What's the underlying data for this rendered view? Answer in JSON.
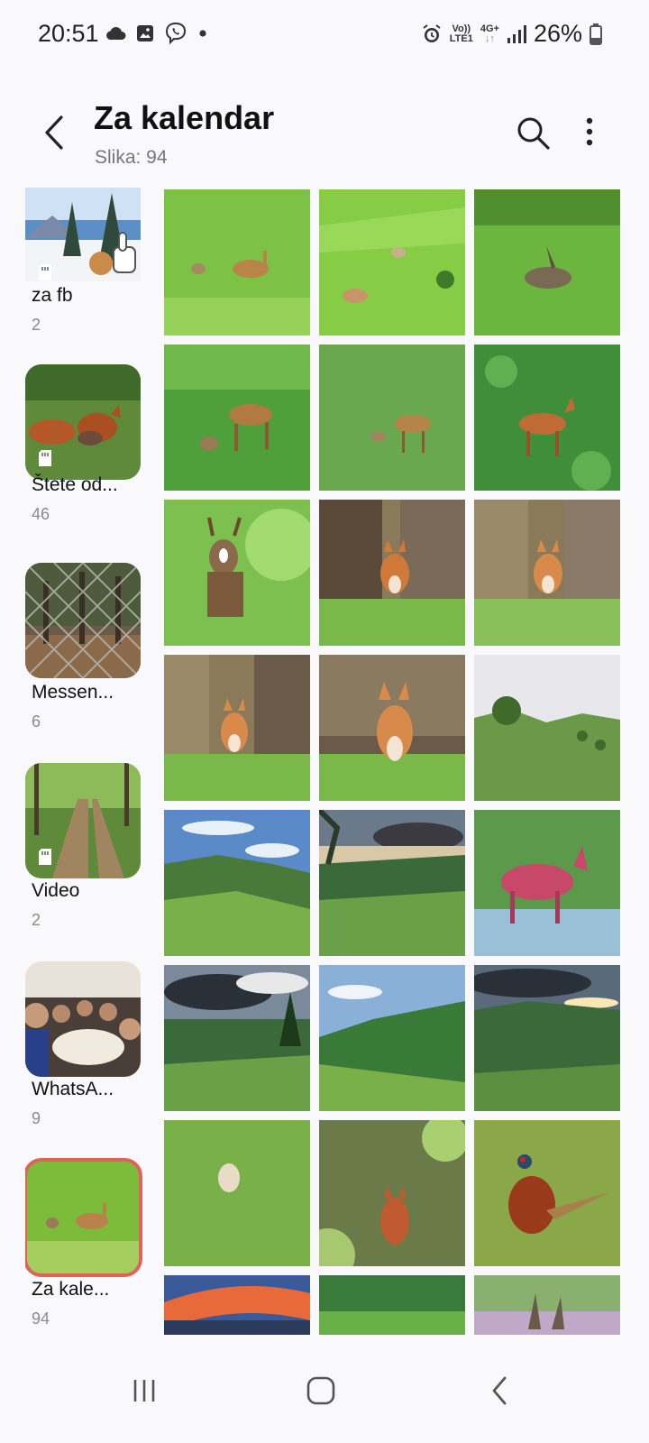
{
  "status_bar": {
    "time": "20:51",
    "battery_pct": "26%",
    "volte_label_top": "Vo))",
    "volte_label_bottom": "LTE1",
    "network_label": "4G+"
  },
  "header": {
    "title": "Za kalendar",
    "subtitle": "Slika: 94"
  },
  "albums": [
    {
      "name": "za fb",
      "count": "2"
    },
    {
      "name": "Štete od...",
      "count": "46"
    },
    {
      "name": "Messen...",
      "count": "6"
    },
    {
      "name": "Video",
      "count": "2"
    },
    {
      "name": "WhatsA...",
      "count": "9"
    },
    {
      "name": "Za kale...",
      "count": "94"
    }
  ],
  "photos": [
    "deer-doe-and-fawn-in-meadow",
    "deer-fawns-in-meadow",
    "hare-in-grass",
    "roe-deer-buck-with-fawn",
    "roe-deer-with-fawn",
    "roe-deer-buck-in-green-field",
    "roe-deer-buck-portrait",
    "fox-cub-by-hay-bale",
    "fox-cub-by-hay-bale-2",
    "fox-cub-by-hay-bale-3",
    "fox-cub-sitting-by-hay",
    "green-hill-landscape",
    "mountain-valley-landscape",
    "hills-with-dramatic-sky",
    "roe-deer-in-red-tones",
    "cloudy-valley-landscape",
    "green-hills-blue-sky",
    "sunset-over-hills",
    "fawn-in-grass",
    "fox-walking-in-meadow",
    "pheasant-in-grass",
    "sunset-sky",
    "green-meadow",
    "hare-ears-in-flowers"
  ]
}
